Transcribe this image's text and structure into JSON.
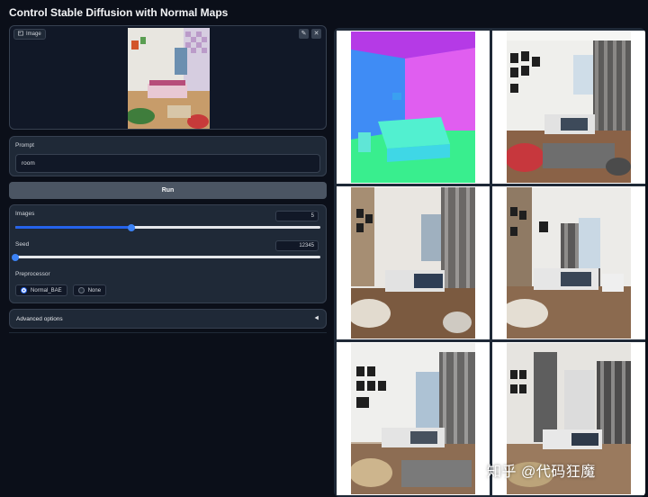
{
  "app": {
    "title": "Control Stable Diffusion with Normal Maps"
  },
  "image_input": {
    "label": "Image",
    "edit_icon": "pencil-icon",
    "clear_icon": "close-icon"
  },
  "prompt": {
    "label": "Prompt",
    "value": "room"
  },
  "run_button": {
    "label": "Run"
  },
  "images_slider": {
    "label": "Images",
    "value": "5",
    "fraction": 0.38
  },
  "seed_slider": {
    "label": "Seed",
    "value": "12345",
    "fraction": 0.0
  },
  "preprocessor": {
    "label": "Preprocessor",
    "options": [
      {
        "label": "Normal_BAE",
        "selected": true
      },
      {
        "label": "None",
        "selected": false
      }
    ]
  },
  "advanced_options": {
    "label": "Advanced options",
    "icon": "collapse-arrow-icon"
  },
  "watermark": {
    "text": "知乎 @代码狂魔"
  },
  "colors": {
    "accent": "#2563eb",
    "background": "#0b0f19",
    "panel": "#1f2937"
  }
}
